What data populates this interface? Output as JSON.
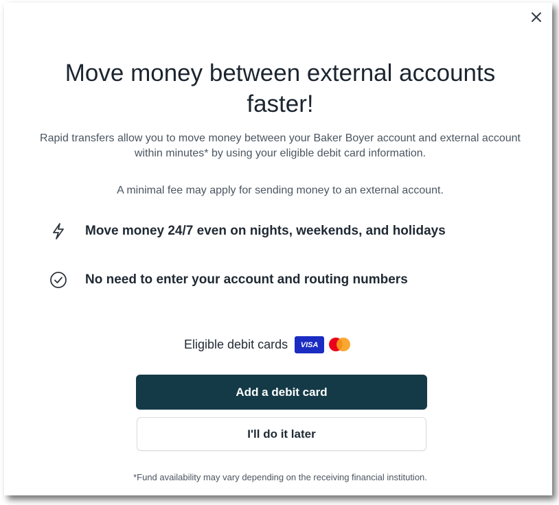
{
  "dialog": {
    "close_icon": "close-icon",
    "title": "Move money between external accounts faster!",
    "intro": "Rapid transfers allow you to move money between your Baker Boyer account and external account within minutes* by using your eligible debit card information.",
    "fee_note": "A minimal fee may apply for sending money to an external account.",
    "features": [
      {
        "icon": "lightning-icon",
        "text": "Move money 24/7 even on nights, weekends, and holidays"
      },
      {
        "icon": "check-circle-icon",
        "text": "No need to enter your account and routing numbers"
      }
    ],
    "eligible_label": "Eligible debit cards",
    "card_brands": [
      {
        "name": "VISA",
        "color": "#1a2cc2"
      },
      {
        "name": "mastercard",
        "colors": [
          "#eb001b",
          "#f79e1b"
        ]
      }
    ],
    "primary_button": "Add a debit card",
    "secondary_button": "I'll do it later",
    "footnote": "*Fund availability may vary depending on the receiving financial institution.",
    "accent_color": "#153a47"
  }
}
